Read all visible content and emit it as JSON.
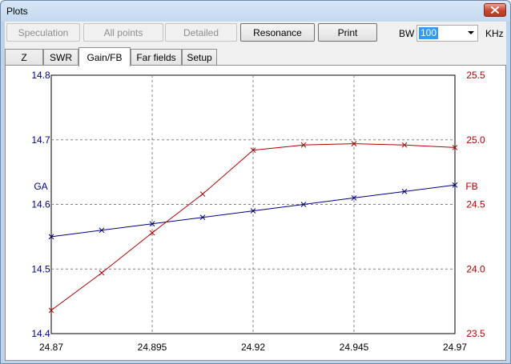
{
  "window": {
    "title": "Plots"
  },
  "toolbar": {
    "buttons": [
      {
        "label": "Speculation",
        "enabled": false
      },
      {
        "label": "All points",
        "enabled": false
      },
      {
        "label": "Detailed",
        "enabled": false
      },
      {
        "label": "Resonance",
        "enabled": true
      },
      {
        "label": "Print",
        "enabled": true
      }
    ],
    "bw_label": "BW",
    "bw_value": "100",
    "unit_label": "KHz"
  },
  "tabs": [
    {
      "label": "Z",
      "selected": false
    },
    {
      "label": "SWR",
      "selected": false
    },
    {
      "label": "Gain/FB",
      "selected": true
    },
    {
      "label": "Far fields",
      "selected": false
    },
    {
      "label": "Setup",
      "selected": false
    }
  ],
  "chart_data": {
    "type": "line",
    "x": [
      24.87,
      24.88,
      24.89,
      24.9,
      24.91,
      24.92,
      24.93,
      24.94,
      24.95,
      24.96,
      24.97
    ],
    "x_ticks": [
      "24.87",
      "24.895",
      "24.92",
      "24.945",
      "24.97"
    ],
    "xlim": [
      24.87,
      24.97
    ],
    "grid": true,
    "series": [
      {
        "name": "GA",
        "axis": "left",
        "color": "#000080",
        "marker": "x",
        "values": [
          14.55,
          14.56,
          14.57,
          14.58,
          14.59,
          14.6,
          14.61,
          14.62,
          14.63
        ],
        "x": [
          24.87,
          24.8825,
          24.895,
          24.9075,
          24.92,
          24.9325,
          24.945,
          24.9575,
          24.97
        ]
      },
      {
        "name": "FB",
        "axis": "right",
        "color": "#b00000",
        "marker": "x",
        "values": [
          23.68,
          23.97,
          24.28,
          24.58,
          24.92,
          24.96,
          24.97,
          24.96,
          24.94
        ],
        "x": [
          24.87,
          24.8825,
          24.895,
          24.9075,
          24.92,
          24.9325,
          24.945,
          24.9575,
          24.97
        ]
      }
    ],
    "left_axis": {
      "label": "GA",
      "color": "#000080",
      "ylim": [
        14.4,
        14.8
      ],
      "ticks": [
        "14.4",
        "14.5",
        "14.6",
        "14.7",
        "14.8"
      ]
    },
    "right_axis": {
      "label": "FB",
      "color": "#b00000",
      "ylim": [
        23.5,
        25.5
      ],
      "ticks": [
        "23.5",
        "24.0",
        "24.5",
        "25.0",
        "25.5"
      ]
    }
  }
}
